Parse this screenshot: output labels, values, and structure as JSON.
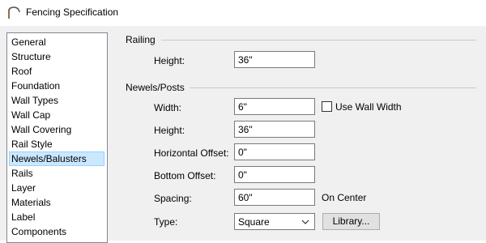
{
  "window": {
    "title": "Fencing Specification"
  },
  "sidebar": {
    "items": [
      {
        "label": "General"
      },
      {
        "label": "Structure"
      },
      {
        "label": "Roof"
      },
      {
        "label": "Foundation"
      },
      {
        "label": "Wall Types"
      },
      {
        "label": "Wall Cap"
      },
      {
        "label": "Wall Covering"
      },
      {
        "label": "Rail Style"
      },
      {
        "label": "Newels/Balusters",
        "selected": true
      },
      {
        "label": "Rails"
      },
      {
        "label": "Layer"
      },
      {
        "label": "Materials"
      },
      {
        "label": "Label"
      },
      {
        "label": "Components"
      }
    ]
  },
  "railing": {
    "group_label": "Railing",
    "height_label": "Height:",
    "height_value": "36\""
  },
  "newels": {
    "group_label": "Newels/Posts",
    "width_label": "Width:",
    "width_value": "6\"",
    "use_wall_width_label": "Use Wall Width",
    "use_wall_width_checked": false,
    "height_label": "Height:",
    "height_value": "36\"",
    "h_offset_label": "Horizontal Offset:",
    "h_offset_value": "0\"",
    "bottom_offset_label": "Bottom Offset:",
    "bottom_offset_value": "0\"",
    "spacing_label": "Spacing:",
    "spacing_value": "60\"",
    "spacing_unit": "On Center",
    "type_label": "Type:",
    "type_value": "Square",
    "library_button": "Library..."
  },
  "icons": {
    "app": "fence-arch-icon",
    "dropdown": "chevron-down-icon"
  },
  "colors": {
    "selection": "#cce8ff",
    "selection_border": "#99d1ff",
    "window_bg": "#f0f0f0"
  }
}
